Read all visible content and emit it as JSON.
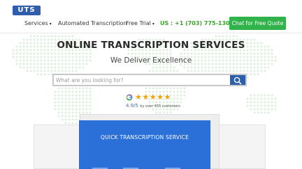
{
  "header": {
    "logo_text": "UTS",
    "nav": [
      {
        "label": "Services"
      },
      {
        "label": "Automated Transcription"
      },
      {
        "label": "Free Trial"
      }
    ],
    "phone": "US : +1 (703) 775-1305",
    "cta_label": "Chat for Free Quote"
  },
  "hero": {
    "title": "ONLINE TRANSCRIPTION SERVICES",
    "subtitle": "We Deliver Excellence",
    "search": {
      "placeholder": "What are you looking for?",
      "value": ""
    },
    "rating": {
      "score": "4.9/5",
      "note": "by over 455 customers",
      "stars": 5
    }
  },
  "card": {
    "title": "QUICK TRANSCRIPTION SERVICE"
  },
  "colors": {
    "brand_blue": "#2f5dab",
    "phone_green": "#37a526",
    "cta_green": "#30b34a",
    "card_blue": "#2b6fd9",
    "star_gold": "#f0a30a"
  },
  "icons": [
    "caret-down-icon",
    "search-icon",
    "google-logo-icon",
    "star-icon"
  ]
}
